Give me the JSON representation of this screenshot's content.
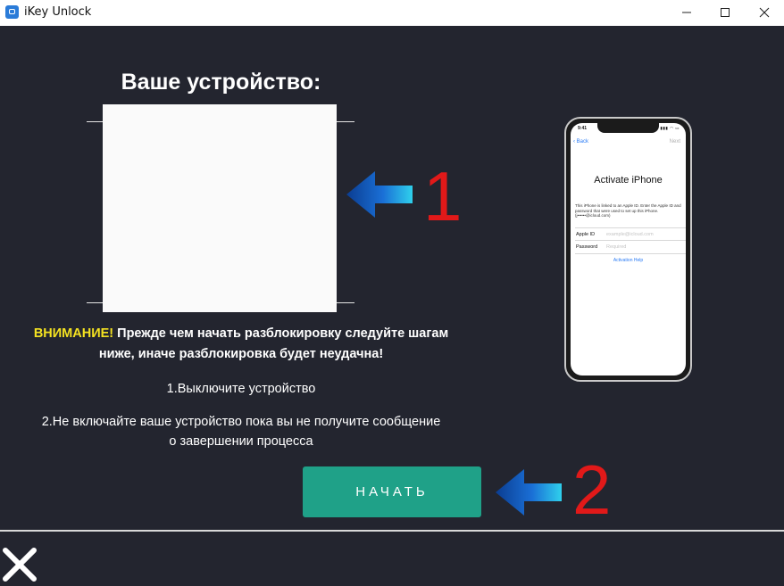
{
  "window": {
    "title": "iKey Unlock",
    "app_icon": "lock-icon",
    "controls": [
      "minimize-icon",
      "maximize-icon",
      "close-icon"
    ]
  },
  "main": {
    "heading": "Ваше устройство:",
    "step_markers": [
      "1",
      "2"
    ],
    "warning_label": "ВНИМАНИЕ!",
    "warning_text_line1": " Прежде чем начать разблокировку следуйте шагам",
    "warning_text_line2": "ниже, иначе разблокировка будет неудачна!",
    "step1": "1.Выключите устройство",
    "step2_line1": "2.Не включайте ваше устройство пока вы не получите сообщение",
    "step2_line2": "о завершении процесса",
    "start_button": "НАЧАТЬ"
  },
  "phone": {
    "time": "9:41",
    "back": "Back",
    "next": "Next",
    "title": "Activate iPhone",
    "description": "This iPhone is linked to an Apple ID. Enter the Apple ID and password that were used to set up this iPhone. (j••••••@icloud.com)",
    "apple_id_label": "Apple ID",
    "apple_id_placeholder": "example@icloud.com",
    "password_label": "Password",
    "password_placeholder": "Required",
    "help_link": "Activation Help"
  },
  "footer": {
    "close_icon": "close-x-icon"
  },
  "colors": {
    "background": "#23252f",
    "accent_button": "#1fa188",
    "warning": "#f4e221",
    "step_number": "#e11919",
    "arrow": "#1a6fd6"
  }
}
